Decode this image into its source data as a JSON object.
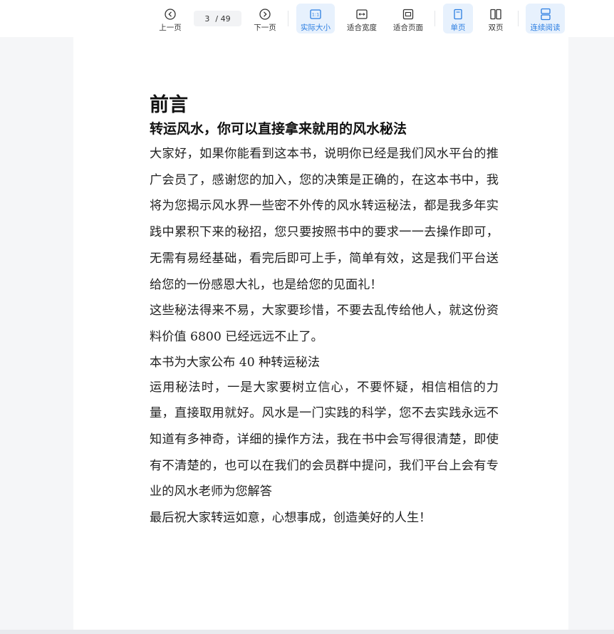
{
  "toolbar": {
    "prev_label": "上一页",
    "next_label": "下一页",
    "page_current": "3",
    "page_total": "/ 49",
    "actual_size_label": "实际大小",
    "fit_width_label": "适合宽度",
    "fit_page_label": "适合页面",
    "single_page_label": "单页",
    "double_page_label": "双页",
    "continuous_label": "连续阅读",
    "accent_color": "#2a7de1"
  },
  "document": {
    "title": "前言",
    "subtitle": "转运风水，你可以直接拿来就用的风水秘法",
    "paragraphs": [
      "大家好，如果你能看到这本书，说明你已经是我们风水平台的推广会员了，感谢您的加入，您的决策是正确的，在这本书中，我将为您揭示风水界一些密不外传的风水转运秘法，都是我多年实践中累积下来的秘招，您只要按照书中的要求一一去操作即可，无需有易经基础，看完后即可上手，简单有效，这是我们平台送给您的一份感恩大礼，也是给您的见面礼！",
      "这些秘法得来不易，大家要珍惜，不要去乱传给他人，就这份资料价值 6800 已经远远不止了。",
      "本书为大家公布 40 种转运秘法",
      "运用秘法时，一是大家要树立信心，不要怀疑，相信相信的力量，直接取用就好。风水是一门实践的科学，您不去实践永远不知道有多神奇，详细的操作方法，我在书中会写得很清楚，即使有不清楚的，也可以在我们的会员群中提问，我们平台上会有专业的风水老师为您解答",
      "最后祝大家转运如意，心想事成，创造美好的人生！"
    ]
  }
}
